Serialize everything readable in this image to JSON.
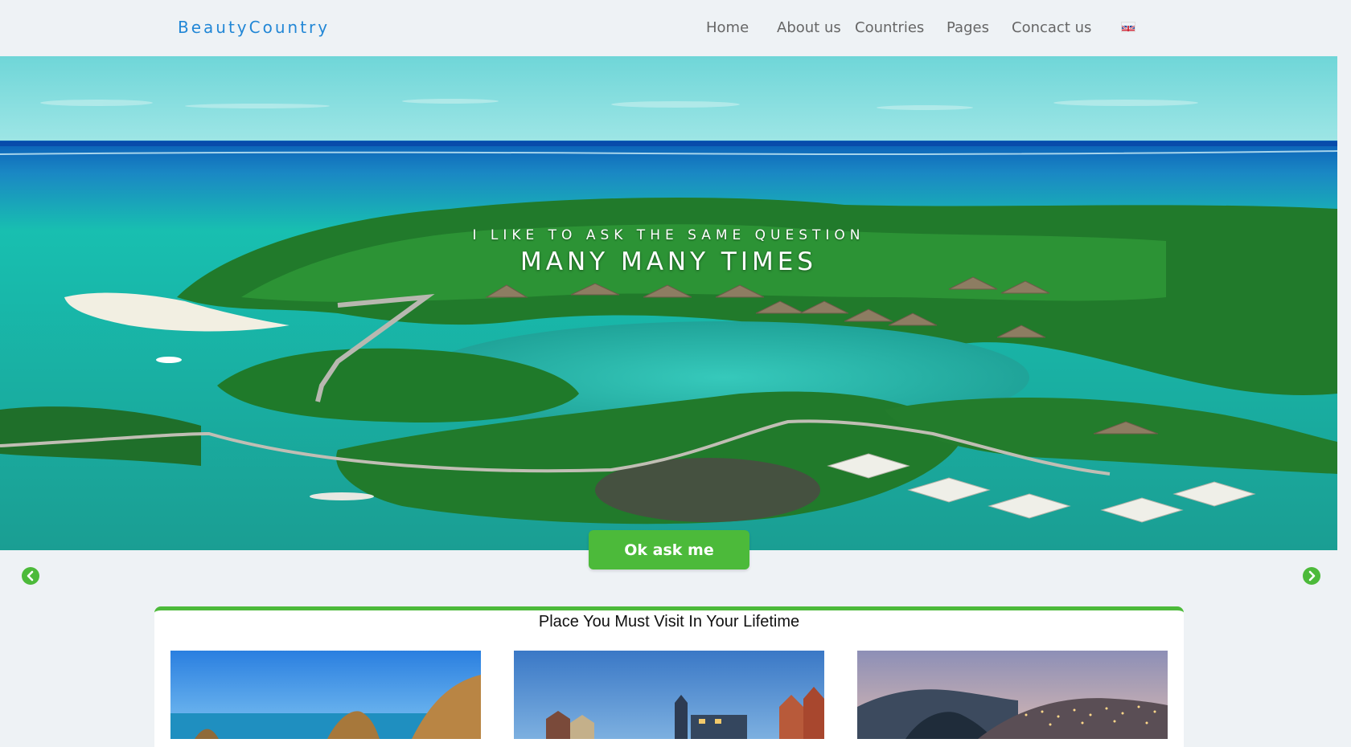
{
  "brand": "BeautyCountry",
  "nav": {
    "items": [
      {
        "label": "Home"
      },
      {
        "label": "About us"
      },
      {
        "label": "Countries"
      },
      {
        "label": "Pages"
      },
      {
        "label": "Concact us"
      }
    ],
    "language_icon": "uk-flag-icon"
  },
  "hero": {
    "subtitle": "I LIKE TO ASK THE SAME QUESTION",
    "title": "MANY MANY TIMES",
    "cta_label": "Ok ask me",
    "prev_icon": "chevron-left-icon",
    "next_icon": "chevron-right-icon"
  },
  "section": {
    "title": "Place You Must Visit In Your Lifetime",
    "cards": [
      {
        "image": "coastal-rocks-photo"
      },
      {
        "image": "european-town-photo"
      },
      {
        "image": "city-night-photo"
      }
    ]
  },
  "colors": {
    "brand": "#2287d6",
    "accent_green": "#4cba3a",
    "nav_text": "#666666",
    "page_bg": "#eef2f5"
  }
}
